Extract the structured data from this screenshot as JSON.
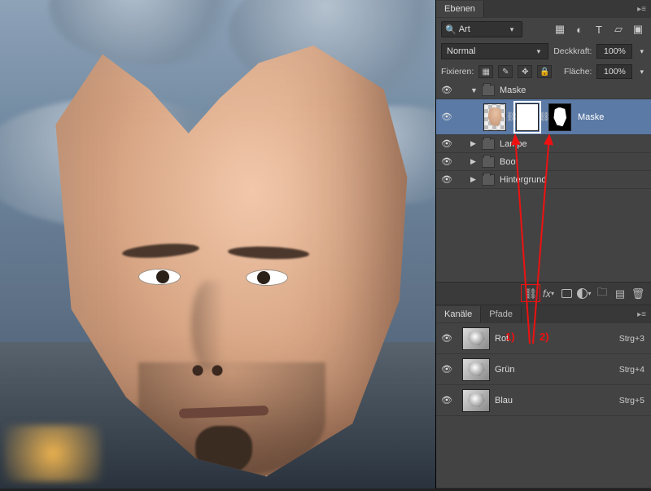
{
  "panel": {
    "tab_layers": "Ebenen"
  },
  "search": {
    "placeholder": "Art"
  },
  "blend": {
    "mode": "Normal",
    "opacity_label": "Deckkraft:",
    "opacity_value": "100%",
    "lock_label": "Fixieren:",
    "fill_label": "Fläche:",
    "fill_value": "100%"
  },
  "groups": {
    "maske": "Maske",
    "lampe": "Lampe",
    "boot": "Boot",
    "hg": "Hintergrund"
  },
  "layer": {
    "maske_name": "Maske"
  },
  "channels": {
    "tab1": "Kanäle",
    "tab2": "Pfade",
    "rot": "Rot",
    "gruen": "Grün",
    "blau": "Blau",
    "rot_key": "Strg+3",
    "gruen_key": "Strg+4",
    "blau_key": "Strg+5"
  },
  "annot": {
    "one": "1)",
    "two": "2)"
  },
  "footer": {
    "fx": "fx"
  }
}
